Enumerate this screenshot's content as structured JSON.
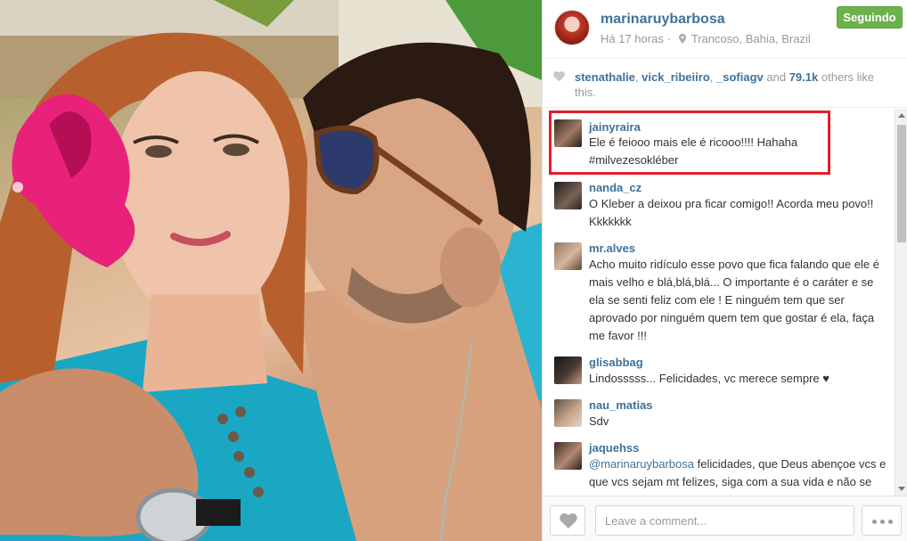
{
  "photo": {
    "icon": "couple-selfie-photo"
  },
  "header": {
    "username": "marinaruybarbosa",
    "time": "Há 17 horas",
    "separator": "·",
    "location": "Trancoso, Bahia, Brazil",
    "follow_label": "Seguindo",
    "follow_color": "#6bb24b"
  },
  "likes": {
    "users": [
      "stenathalie",
      "vick_ribeiiro",
      "_sofiagv"
    ],
    "and_word": "and",
    "count": "79.1k",
    "suffix": "others like this."
  },
  "comments": [
    {
      "user": "jainyraira",
      "text": "Ele é feiooo mais ele é ricooo!!!! Hahaha #milvezesokléber"
    },
    {
      "user": "nanda_cz",
      "text": "O Kleber a deixou pra ficar comigo!! Acorda meu povo!! Kkkkkkk"
    },
    {
      "user": "mr.alves",
      "text": "Acho muito ridículo esse povo que fica falando que ele é mais velho e blá,blá,blá... O importante é o caráter e se ela se senti feliz com ele ! E ninguém tem que ser aprovado por ninguém quem tem que gostar é ela, faça me favor !!!"
    },
    {
      "user": "glisabbag",
      "text": "Lindosssss... Felicidades, vc merece sempre ♥"
    },
    {
      "user": "nau_matias",
      "text": "Sdv"
    },
    {
      "user": "jaquehss",
      "mention": "@marinaruybarbosa",
      "text": " felicidades, que Deus abençoe vcs e que vcs sejam mt felizes, siga com a sua vida e não se preocupe"
    }
  ],
  "footer": {
    "comment_placeholder": "Leave a comment..."
  },
  "colors": {
    "link": "#3f729b",
    "highlight": "#e51d2a"
  }
}
